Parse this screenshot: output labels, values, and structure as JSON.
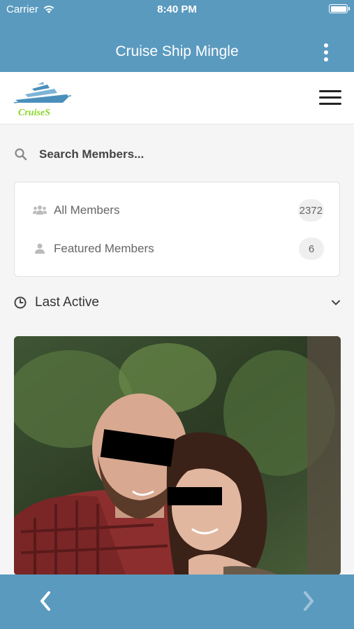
{
  "status_bar": {
    "carrier": "Carrier",
    "time": "8:40 PM"
  },
  "app_bar": {
    "title": "Cruise Ship Mingle"
  },
  "header": {
    "logo_text": "CruiseS"
  },
  "search": {
    "placeholder": "Search Members..."
  },
  "members": {
    "items": [
      {
        "label": "All Members",
        "count": "2372",
        "icon": "group-icon"
      },
      {
        "label": "Featured Members",
        "count": "6",
        "icon": "user-icon"
      }
    ]
  },
  "filter": {
    "label": "Last Active",
    "icon": "clock-icon"
  },
  "colors": {
    "accent": "#5b9abf",
    "logo_green": "#8bd62a"
  }
}
